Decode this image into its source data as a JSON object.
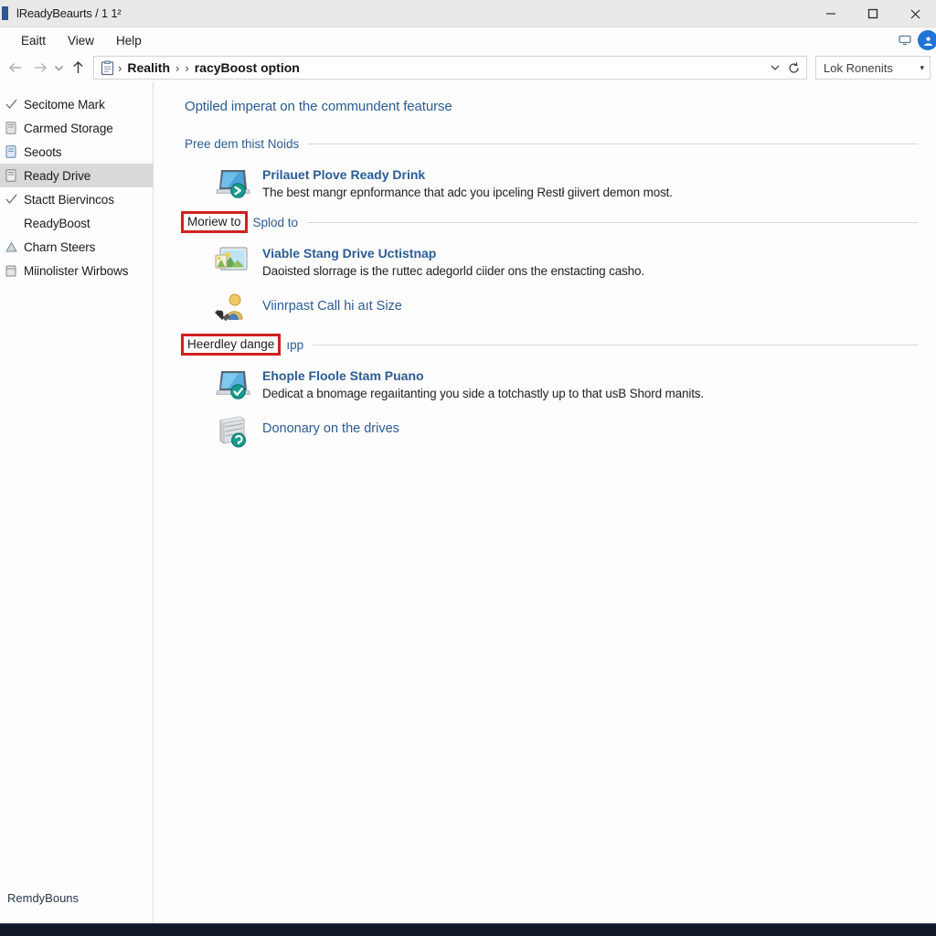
{
  "window": {
    "title": "lReadyBeaurts / 1 1²",
    "minimize_label": "─",
    "maximize_label": "☐",
    "close_label": "✕"
  },
  "menubar": {
    "items": [
      {
        "label": "Eaitt",
        "name": "menu-edit"
      },
      {
        "label": "View",
        "name": "menu-view"
      },
      {
        "label": "Help",
        "name": "menu-help"
      }
    ],
    "tray_icon": "monitor-icon",
    "account_icon": "account-circle-icon"
  },
  "addressbar": {
    "back_icon": "back-arrow-icon",
    "forward_icon": "forward-arrow-icon",
    "history_icon": "chevron-down-icon",
    "up_icon": "up-arrow-icon",
    "crumb_icon": "folder-document-icon",
    "separator": "›",
    "crumbs": [
      "Realith",
      "",
      "racyBoost option"
    ],
    "dropdown_icon": "chevron-down-icon",
    "refresh_icon": "refresh-icon",
    "search": {
      "value": "Lok Ronenits",
      "placeholder": "Lok Ronenits",
      "caret_icon": "chevron-down-icon"
    }
  },
  "sidebar": {
    "items": [
      {
        "label": "Secitome Mark",
        "icon": "check-icon",
        "selected": false
      },
      {
        "label": "Carmed Storage",
        "icon": "drive-icon",
        "selected": false
      },
      {
        "label": "Seoots",
        "icon": "document-icon",
        "selected": false
      },
      {
        "label": "Ready Drive",
        "icon": "drive-icon",
        "selected": true
      },
      {
        "label": "Stactt Biervincos",
        "icon": "check-icon",
        "selected": false
      },
      {
        "label": "ReadyBoost",
        "icon": "",
        "selected": false
      },
      {
        "label": "Charn Steers",
        "icon": "triangle-icon",
        "selected": false
      },
      {
        "label": "Miinolister Wirbows",
        "icon": "window-icon",
        "selected": false
      }
    ],
    "status": "RemdyBouns"
  },
  "content": {
    "title": "Optiled imperat on the commundent featurse",
    "sections": [
      {
        "name": "section-free-dem",
        "head_text": "Pree dem thist Noids",
        "head_boxed": false,
        "head_tail": "",
        "entries": [
          {
            "name": "entry-prilauet-plove",
            "icon": "laptop-boost-icon",
            "title": "Prilauet Plove Ready Drink",
            "bold": true,
            "desc": "The best mangr epnformance that adc you ipceling Restł giivert demon most."
          }
        ]
      },
      {
        "name": "section-moriew-to",
        "head_text": "Moriew to",
        "head_boxed": true,
        "head_tail": "Splod to",
        "entries": [
          {
            "name": "entry-viable-stang-drive",
            "icon": "picture-monitor-icon",
            "title": "Viable Stang Drive Uctistnap",
            "bold": true,
            "desc": "Daoisted slorrage is the гuttec adegorld ciider onѕ the enstacting casho."
          },
          {
            "name": "entry-viinrpast-call",
            "icon": "user-tools-icon",
            "title": "Viinrpast Call hi aıt Size",
            "bold": false,
            "desc": ""
          }
        ]
      },
      {
        "name": "section-heerdley-dange",
        "head_text": "Heerdley dange",
        "head_boxed": true,
        "head_tail": "ıpp",
        "entries": [
          {
            "name": "entry-ehople-floole",
            "icon": "laptop-check-icon",
            "title": "Ehople Floole Stam Puano",
            "bold": true,
            "desc": "Dedicat a bnomage regaıitanting you side a totchastly up to that usB Shord manitѕ."
          },
          {
            "name": "entry-dononary-drives",
            "icon": "drive-stack-icon",
            "title": "Dononary on the drives",
            "bold": false,
            "desc": ""
          }
        ]
      }
    ]
  },
  "colors": {
    "accent_blue": "#2b5c94",
    "highlight_red": "#d02020",
    "selection_gray": "#d9d9d9",
    "titlebar_gray": "#e9e9e9",
    "badge_teal": "#169b8e"
  }
}
